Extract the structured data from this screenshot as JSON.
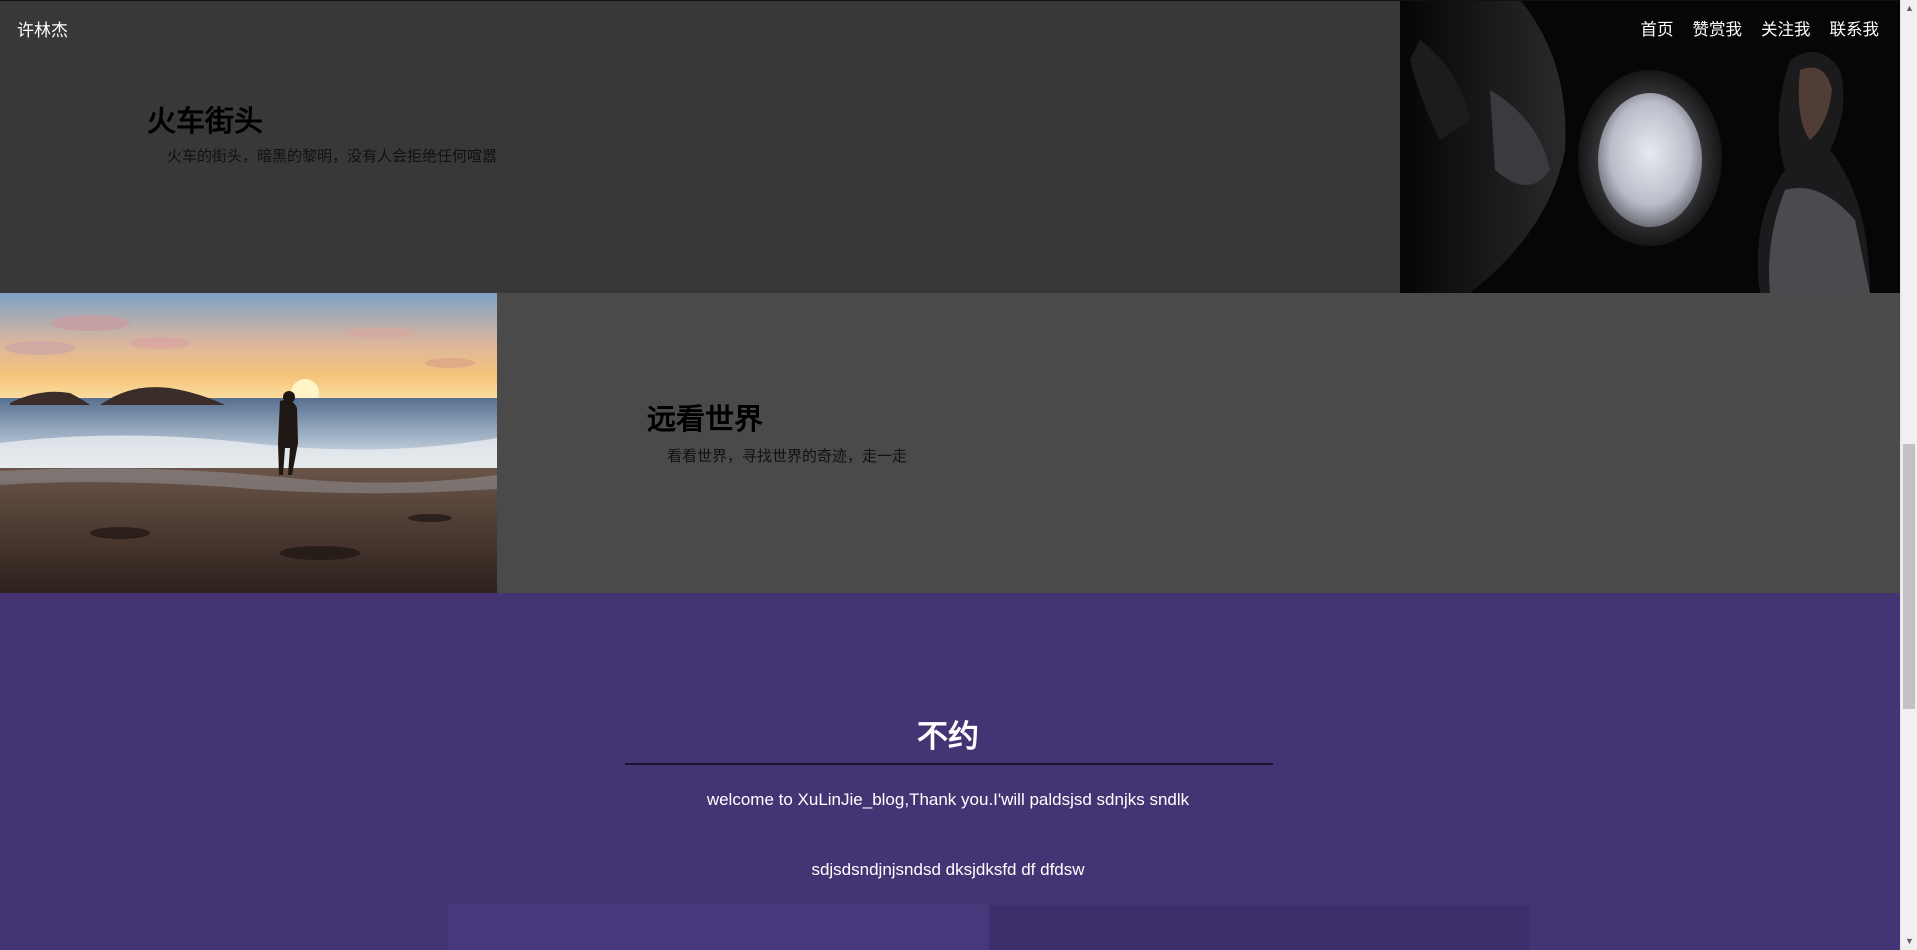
{
  "nav": {
    "brand": "许林杰",
    "links": [
      "首页",
      "赞赏我",
      "关注我",
      "联系我"
    ]
  },
  "section1": {
    "title": "火车街头",
    "description": "火车的街头，暗黑的黎明，没有人会拒绝任何喧嚣"
  },
  "section2": {
    "title": "远看世界",
    "description": "看看世界，寻找世界的奇迹，走一走"
  },
  "section3": {
    "heading": "不约",
    "line1": "welcome to XuLinJie_blog,Thank you.I'will paldsjsd sdnjks sndlk",
    "line2": "sdjsdsndjnjsndsd dksjdksfd df dfdsw"
  },
  "colors": {
    "section1_bg": "#383838",
    "section2_bg": "#4a4a4a",
    "section3_bg": "#443474"
  }
}
